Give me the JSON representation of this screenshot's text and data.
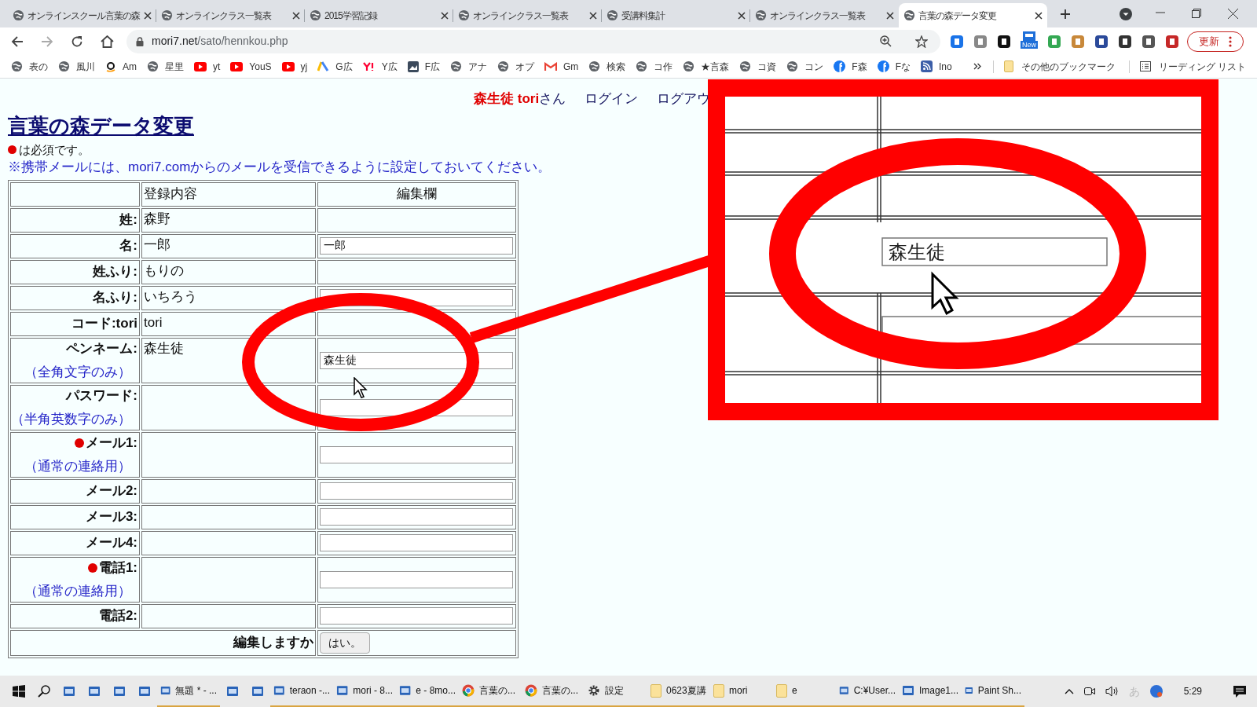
{
  "browser": {
    "tabs": [
      {
        "title": "オンラインスクール言葉の森",
        "selected": false
      },
      {
        "title": "オンラインクラス一覧表",
        "selected": false
      },
      {
        "title": "2015学習記録",
        "selected": false
      },
      {
        "title": "オンラインクラス一覧表",
        "selected": false
      },
      {
        "title": "受講料集計",
        "selected": false
      },
      {
        "title": "オンラインクラス一覧表",
        "selected": false
      },
      {
        "title": "言葉の森データ変更",
        "selected": true
      }
    ],
    "url": "mori7.net/sato/hennkou.php",
    "extension_badge": "New",
    "update_button": "更新",
    "bookmarks": [
      {
        "label": "表の",
        "kind": "globe"
      },
      {
        "label": "風川",
        "kind": "globe"
      },
      {
        "label": "Am",
        "kind": "amazon"
      },
      {
        "label": "星里",
        "kind": "globe"
      },
      {
        "label": "yt",
        "kind": "youtube"
      },
      {
        "label": "YouS",
        "kind": "youtube"
      },
      {
        "label": "yj",
        "kind": "youtube"
      },
      {
        "label": "G広",
        "kind": "ads"
      },
      {
        "label": "Y広",
        "kind": "yahoo"
      },
      {
        "label": "F広",
        "kind": "image"
      },
      {
        "label": "アナ",
        "kind": "globe"
      },
      {
        "label": "オプ",
        "kind": "globe"
      },
      {
        "label": "Gm",
        "kind": "gmail"
      },
      {
        "label": "検索",
        "kind": "globe"
      },
      {
        "label": "コ作",
        "kind": "globe"
      },
      {
        "label": "★言森",
        "kind": "globe"
      },
      {
        "label": "コ資",
        "kind": "globe"
      },
      {
        "label": "コン",
        "kind": "globe"
      },
      {
        "label": "F森",
        "kind": "facebook"
      },
      {
        "label": "Fな",
        "kind": "facebook"
      },
      {
        "label": "Ino",
        "kind": "rss"
      }
    ],
    "other_bookmarks": "その他のブックマーク",
    "reading_list": "リーディング リスト"
  },
  "page": {
    "user": "森生徒 tori",
    "user_suffix": "さん",
    "nav": [
      "ログイン",
      "ログアウ"
    ],
    "title": "言葉の森データ変更",
    "required_note": "は必須です。",
    "notice": "※携帯メールには、mori7.comからのメールを受信できるように設定しておいてください。",
    "columns": [
      "登録内容",
      "編集欄"
    ],
    "rows": [
      {
        "label": "姓:",
        "registered": "森野",
        "kind": "text",
        "required": false
      },
      {
        "label": "名:",
        "registered": "一郎",
        "kind": "input",
        "value": "一郎",
        "required": false
      },
      {
        "label": "姓ふり:",
        "registered": "もりの",
        "kind": "text",
        "required": false
      },
      {
        "label": "名ふり:",
        "registered": "いちろう",
        "kind": "input",
        "required": false
      },
      {
        "label": "コード:tori",
        "registered": "tori",
        "kind": "text",
        "required": false
      },
      {
        "label": "ペンネーム:",
        "note": "（全角文字のみ）",
        "registered": "森生徒",
        "kind": "input",
        "value": "森生徒",
        "required": false
      },
      {
        "label": "パスワード:",
        "note": "（半角英数字のみ）",
        "kind": "input",
        "required": false
      },
      {
        "label": "メール1:",
        "note": "（通常の連絡用）",
        "kind": "input",
        "required": true
      },
      {
        "label": "メール2:",
        "kind": "input",
        "required": false
      },
      {
        "label": "メール3:",
        "kind": "input",
        "required": false
      },
      {
        "label": "メール4:",
        "kind": "input",
        "required": false
      },
      {
        "label": "電話1:",
        "note": "（通常の連絡用）",
        "kind": "input",
        "required": true
      },
      {
        "label": "電話2:",
        "kind": "input",
        "required": false
      }
    ],
    "submit_label": "編集しますか",
    "submit_button": "はい。"
  },
  "magnifier": {
    "value": "森生徒"
  },
  "taskbar": {
    "items": [
      {
        "kind": "start"
      },
      {
        "kind": "search"
      },
      {
        "kind": "app"
      },
      {
        "kind": "app"
      },
      {
        "kind": "app"
      },
      {
        "kind": "app"
      },
      {
        "kind": "app",
        "label": "無題 * - ..."
      },
      {
        "kind": "app"
      },
      {
        "kind": "app"
      },
      {
        "kind": "app",
        "label": "teraon -..."
      },
      {
        "kind": "app",
        "label": "mori - 8..."
      },
      {
        "kind": "app",
        "label": "e - 8mo..."
      },
      {
        "kind": "chrome",
        "label": "言葉の..."
      },
      {
        "kind": "chrome",
        "label": "言葉の..."
      },
      {
        "kind": "gear",
        "label": "設定"
      },
      {
        "kind": "folder",
        "label": "0623夏講"
      },
      {
        "kind": "folder",
        "label": "mori"
      },
      {
        "kind": "folder",
        "label": "e"
      },
      {
        "kind": "app",
        "label": "C:¥User..."
      },
      {
        "kind": "app",
        "label": "Image1..."
      },
      {
        "kind": "app",
        "label": "Paint Sh..."
      }
    ],
    "ime": "あ",
    "time": "5:29"
  }
}
